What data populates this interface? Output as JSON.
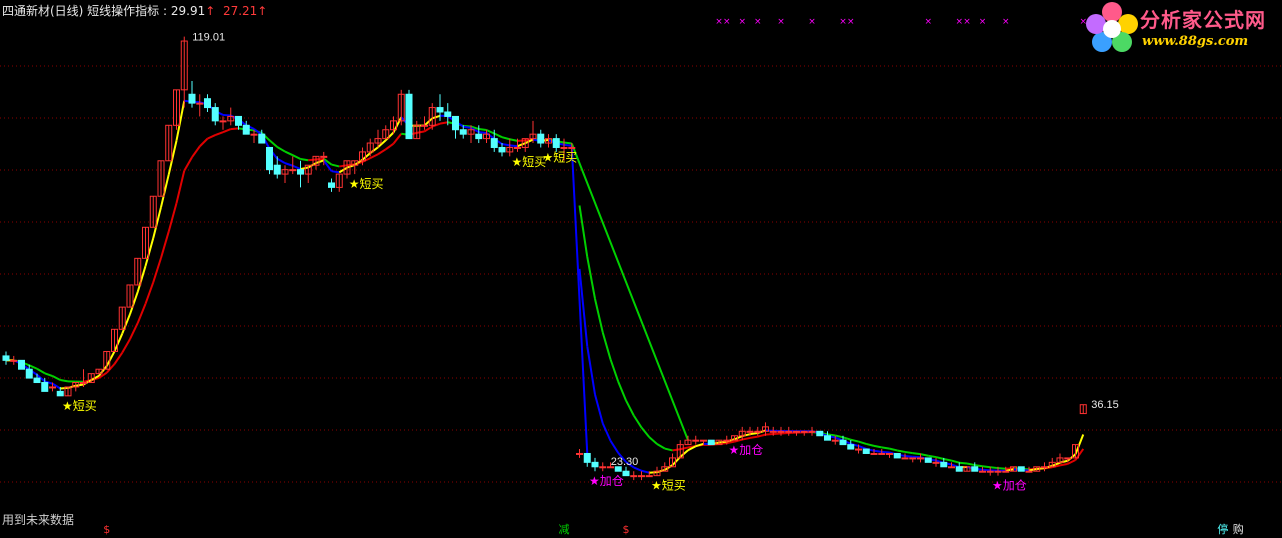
{
  "header": {
    "title": "四通新材(日线) 短线操作指标",
    "value_1": ": 29.91",
    "value_2": "27.21",
    "arrow": "↑"
  },
  "watermark": {
    "line1": "分析家公式网",
    "line2": "www.88gs.com"
  },
  "footer": {
    "text": "用到未来数据"
  },
  "colors": {
    "up": "#ff3232",
    "down": "#54ffff",
    "bg": "#000000",
    "grid": "#8b0000",
    "yellow_line": "#ffff00",
    "red_line": "#e00000",
    "green_line": "#00d000",
    "blue_line": "#0000ff",
    "buy_signal": "#ffff00",
    "add_signal": "#ff00ff"
  },
  "chart_data": {
    "type": "candlestick",
    "title": "",
    "price_labels": [
      {
        "label": "119.01",
        "price": 119.01
      },
      {
        "label": "36.15",
        "price": 36.15
      },
      {
        "label": "23.30",
        "price": 23.3
      }
    ],
    "ylim": [
      10,
      125
    ],
    "candles": [
      [
        47,
        48,
        45,
        46
      ],
      [
        46,
        47,
        45,
        46
      ],
      [
        46,
        46,
        44,
        44
      ],
      [
        44,
        45,
        42,
        42
      ],
      [
        42,
        43,
        41,
        41
      ],
      [
        41,
        42,
        39,
        39
      ],
      [
        40,
        41,
        39,
        40
      ],
      [
        39,
        40,
        38,
        38
      ],
      [
        38,
        40,
        38,
        40
      ],
      [
        40,
        41,
        39,
        41
      ],
      [
        41,
        44,
        40,
        41
      ],
      [
        41,
        43,
        41,
        43
      ],
      [
        43,
        44,
        43,
        44
      ],
      [
        44,
        48,
        44,
        48
      ],
      [
        48,
        53,
        48,
        53
      ],
      [
        53,
        58,
        53,
        58
      ],
      [
        58,
        63,
        58,
        63
      ],
      [
        63,
        69,
        63,
        69
      ],
      [
        69,
        76,
        69,
        76
      ],
      [
        76,
        83,
        76,
        83
      ],
      [
        83,
        91,
        83,
        91
      ],
      [
        91,
        99,
        91,
        99
      ],
      [
        99,
        107,
        98,
        107
      ],
      [
        107,
        119,
        103,
        118
      ],
      [
        106,
        109,
        103,
        104
      ],
      [
        104,
        106,
        101,
        104
      ],
      [
        105,
        106,
        102,
        103
      ],
      [
        103,
        104,
        99,
        100
      ],
      [
        100,
        101,
        98,
        100
      ],
      [
        100,
        103,
        99,
        101
      ],
      [
        101,
        101,
        98,
        99
      ],
      [
        99,
        100,
        97,
        97
      ],
      [
        97,
        98,
        95,
        97
      ],
      [
        97,
        98,
        95,
        95
      ],
      [
        94,
        94,
        88,
        89
      ],
      [
        90,
        92,
        87,
        88
      ],
      [
        88,
        90,
        86,
        89
      ],
      [
        89,
        92,
        88,
        89
      ],
      [
        89,
        91,
        85,
        88
      ],
      [
        88,
        90,
        86,
        90
      ],
      [
        90,
        92,
        89,
        92
      ],
      [
        92,
        93,
        90,
        92
      ],
      [
        86,
        87,
        84,
        85
      ],
      [
        85,
        88,
        84,
        88
      ],
      [
        88,
        91,
        87,
        91
      ],
      [
        90,
        91,
        88,
        91
      ],
      [
        91,
        94,
        90,
        93
      ],
      [
        93,
        96,
        92,
        95
      ],
      [
        95,
        98,
        94,
        96
      ],
      [
        96,
        99,
        96,
        98
      ],
      [
        98,
        101,
        97,
        100
      ],
      [
        100,
        107,
        99,
        106
      ],
      [
        106,
        107,
        96,
        96
      ],
      [
        96,
        100,
        96,
        99
      ],
      [
        99,
        101,
        98,
        99
      ],
      [
        99,
        104,
        98,
        103
      ],
      [
        103,
        106,
        100,
        102
      ],
      [
        102,
        104,
        99,
        101
      ],
      [
        101,
        101,
        96,
        98
      ],
      [
        98,
        99,
        96,
        97
      ],
      [
        97,
        99,
        95,
        98
      ],
      [
        97,
        99,
        95,
        96
      ],
      [
        96,
        98,
        95,
        97
      ],
      [
        96,
        98,
        93,
        94
      ],
      [
        94,
        95,
        92,
        93
      ],
      [
        93,
        96,
        92,
        94
      ],
      [
        94,
        96,
        93,
        94
      ],
      [
        94,
        96,
        93,
        96
      ],
      [
        96,
        100,
        95,
        97
      ],
      [
        97,
        98,
        94,
        95
      ],
      [
        95,
        97,
        94,
        96
      ],
      [
        96,
        97,
        93,
        94
      ],
      [
        94,
        96,
        91,
        94
      ],
      [
        94,
        95,
        92,
        94
      ],
      [
        25,
        26,
        24,
        25
      ],
      [
        25,
        25,
        22,
        23
      ],
      [
        23,
        24,
        21,
        22
      ],
      [
        22,
        23,
        21,
        22
      ],
      [
        22,
        23,
        22,
        22
      ],
      [
        22,
        22,
        21,
        21
      ],
      [
        21,
        22,
        20,
        20
      ],
      [
        20,
        21,
        19,
        20
      ],
      [
        20,
        21,
        19,
        20
      ],
      [
        20,
        21,
        20,
        20
      ],
      [
        20,
        22,
        20,
        21
      ],
      [
        21,
        23,
        21,
        22
      ],
      [
        22,
        25,
        22,
        24
      ],
      [
        24,
        28,
        24,
        27
      ],
      [
        27,
        29,
        27,
        28
      ],
      [
        28,
        29,
        27,
        28
      ],
      [
        28,
        28,
        27,
        28
      ],
      [
        28,
        28,
        27,
        27
      ],
      [
        27,
        28,
        27,
        28
      ],
      [
        28,
        29,
        27,
        28
      ],
      [
        28,
        29,
        28,
        29
      ],
      [
        29,
        31,
        28,
        30
      ],
      [
        30,
        31,
        29,
        30
      ],
      [
        30,
        31,
        29,
        30
      ],
      [
        30,
        32,
        29,
        31
      ],
      [
        30,
        31,
        29,
        30
      ],
      [
        30,
        31,
        29,
        30
      ],
      [
        30,
        31,
        29,
        30
      ],
      [
        30,
        30,
        29,
        30
      ],
      [
        30,
        30,
        29,
        30
      ],
      [
        30,
        31,
        29,
        30
      ],
      [
        30,
        30,
        29,
        29
      ],
      [
        29,
        30,
        28,
        28
      ],
      [
        28,
        29,
        27,
        28
      ],
      [
        28,
        29,
        27,
        27
      ],
      [
        27,
        28,
        26,
        26
      ],
      [
        26,
        27,
        25,
        26
      ],
      [
        26,
        26,
        25,
        25
      ],
      [
        25,
        26,
        25,
        25
      ],
      [
        25,
        26,
        25,
        25
      ],
      [
        25,
        25,
        24,
        25
      ],
      [
        25,
        25,
        24,
        24
      ],
      [
        24,
        25,
        24,
        24
      ],
      [
        24,
        24,
        23,
        24
      ],
      [
        24,
        25,
        23,
        24
      ],
      [
        24,
        24,
        23,
        23
      ],
      [
        23,
        24,
        22,
        23
      ],
      [
        23,
        24,
        22,
        22
      ],
      [
        22,
        23,
        22,
        22
      ],
      [
        22,
        23,
        21,
        21
      ],
      [
        21,
        22,
        21,
        22
      ],
      [
        22,
        23,
        21,
        21
      ],
      [
        21,
        22,
        21,
        21
      ],
      [
        21,
        22,
        20,
        21
      ],
      [
        21,
        22,
        20,
        21
      ],
      [
        21,
        22,
        21,
        21
      ],
      [
        21,
        22,
        21,
        22
      ],
      [
        22,
        22,
        21,
        21
      ],
      [
        21,
        22,
        21,
        21
      ],
      [
        21,
        22,
        21,
        22
      ],
      [
        22,
        23,
        21,
        22
      ],
      [
        22,
        24,
        22,
        23
      ],
      [
        23,
        25,
        23,
        24
      ],
      [
        24,
        24,
        23,
        24
      ],
      [
        24,
        27,
        24,
        27
      ],
      [
        34,
        36,
        34,
        36
      ]
    ],
    "signals": [
      {
        "label": "短买",
        "index": 8,
        "kind": "buy"
      },
      {
        "label": "短买",
        "index": 45,
        "kind": "buy"
      },
      {
        "label": "短买",
        "index": 66,
        "kind": "buy"
      },
      {
        "label": "短买",
        "index": 70,
        "kind": "buy"
      },
      {
        "label": "短买",
        "index": 84,
        "kind": "buy"
      },
      {
        "label": "加仓",
        "index": 76,
        "kind": "add"
      },
      {
        "label": "加仓",
        "index": 94,
        "kind": "add"
      },
      {
        "label": "加仓",
        "index": 128,
        "kind": "add"
      },
      {
        "label": "加仓",
        "index": 141,
        "kind": "add"
      },
      {
        "label": "加仓",
        "index": 151,
        "kind": "add"
      }
    ],
    "bottom_markers": [
      {
        "label": "$",
        "index": 13,
        "color": "#ff3232"
      },
      {
        "label": "减",
        "index": 72,
        "color": "#00d000"
      },
      {
        "label": "$",
        "index": 80,
        "color": "#ff3232"
      },
      {
        "label": "停",
        "index": 157,
        "color": "#54ffff"
      },
      {
        "label": "购",
        "index": 159,
        "color": "#e8e8e8"
      }
    ],
    "top_markers": [
      92,
      93,
      95,
      97,
      100,
      104,
      108,
      109,
      119,
      123,
      124,
      126,
      129,
      139,
      143
    ],
    "top_marker_label": "×"
  }
}
